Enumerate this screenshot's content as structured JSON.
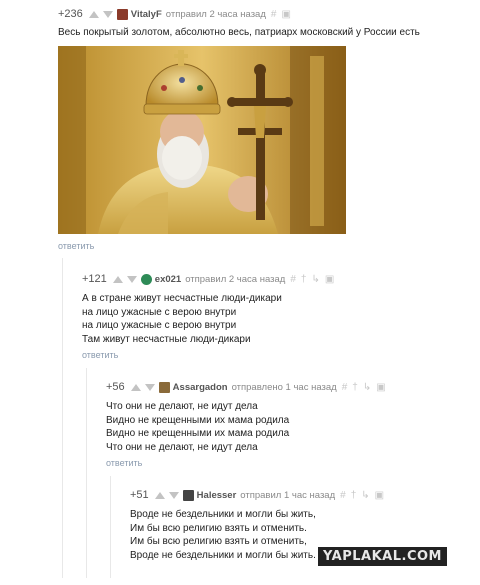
{
  "comments": [
    {
      "rating": "+236",
      "author": "VitalyF",
      "meta": "отправил 2 часа назад",
      "lines": [
        "Весь покрытый золотом, абсолютно весь, патриарх московский у России есть"
      ],
      "reply": "ответить",
      "avatar_color": "#8b3a2a"
    },
    {
      "rating": "+121",
      "author": "ex021",
      "meta": "отправил 2 часа назад",
      "lines": [
        "А в стране живут несчастные люди-дикари",
        "на лицо ужасные с верою внутри",
        "на лицо ужасные с верою внутри",
        "Там живут несчастные люди-дикари"
      ],
      "reply": "ответить",
      "avatar_color": "#2e8b57"
    },
    {
      "rating": "+56",
      "author": "Assargadon",
      "meta": "отправлено 1 час назад",
      "lines": [
        "Что они не делают,  не идут дела",
        "Видно не крещенными их мама родила",
        "Видно не крещенными их мама родила",
        "Что они не делают, не идут дела"
      ],
      "reply": "ответить",
      "avatar_color": "#8a6a3a"
    },
    {
      "rating": "+51",
      "author": "Halesser",
      "meta": "отправил 1 час назад",
      "lines": [
        "Вроде не бездельники и могли бы жить,",
        "Им бы всю религию взять и отменить.",
        "Им бы всю религию взять и отменить,",
        "Вроде не бездельники и могли бы жить."
      ],
      "reply": "",
      "avatar_color": "#444444"
    }
  ],
  "watermark": "YAPLAKAL.COM",
  "icons": [
    "arrow-up-icon",
    "arrow-down-icon",
    "hash-icon",
    "save-icon",
    "link-icon",
    "reply-icon"
  ]
}
